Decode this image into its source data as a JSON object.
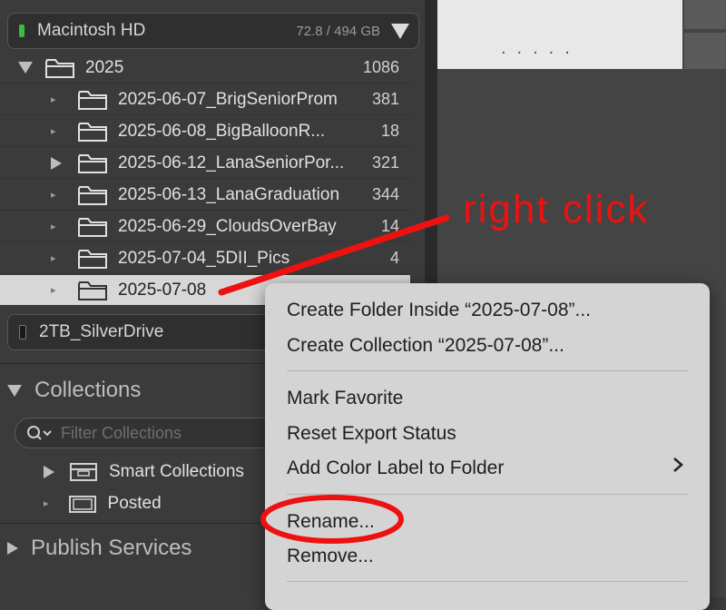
{
  "volumes": [
    {
      "name": "Macintosh HD",
      "size": "72.8 / 494 GB",
      "led_color": "#3dbb45"
    },
    {
      "name": "2TB_SilverDrive",
      "led_color": "#1a1a1a"
    }
  ],
  "root_folder": {
    "name": "2025",
    "count": "1086"
  },
  "folders": [
    {
      "name": "2025-06-07_BrigSeniorProm",
      "count": "381"
    },
    {
      "name": "2025-06-08_BigBalloonR...",
      "count": "18"
    },
    {
      "name": "2025-06-12_LanaSeniorPor...",
      "count": "321"
    },
    {
      "name": "2025-06-13_LanaGraduation",
      "count": "344"
    },
    {
      "name": "2025-06-29_CloudsOverBay",
      "count": "14"
    },
    {
      "name": "2025-07-04_5DII_Pics",
      "count": "4"
    },
    {
      "name": "2025-07-08",
      "count": ""
    }
  ],
  "collections": {
    "title": "Collections",
    "filter_placeholder": "Filter Collections",
    "items": [
      {
        "name": "Smart Collections"
      },
      {
        "name": "Posted"
      }
    ]
  },
  "publish": {
    "title": "Publish Services"
  },
  "context_menu": {
    "items": [
      "Create Folder Inside “2025-07-08”...",
      "Create Collection “2025-07-08”...",
      "Mark Favorite",
      "Reset Export Status",
      "Add Color Label to Folder",
      "Rename...",
      "Remove..."
    ]
  },
  "annotation": {
    "text": "right click",
    "color": "#ee1111"
  },
  "thumbnail": {
    "dots": "....."
  }
}
